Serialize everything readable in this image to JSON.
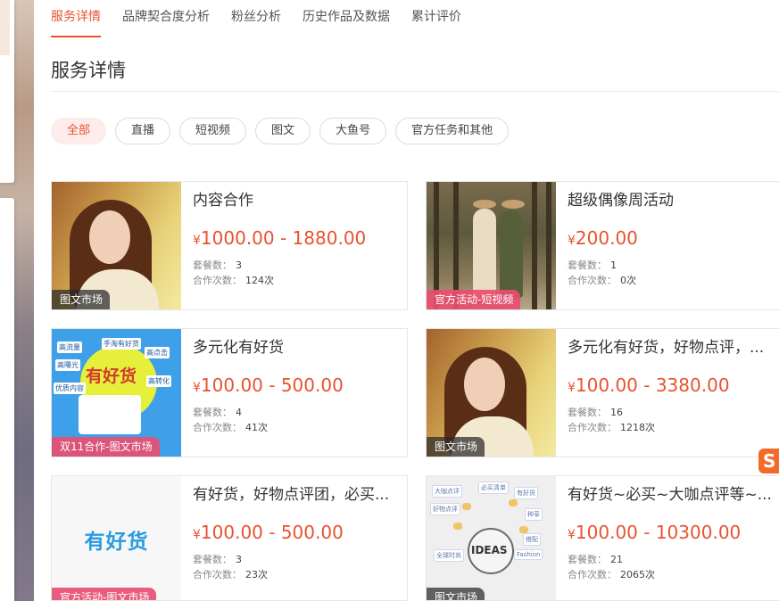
{
  "tabs": [
    {
      "label": "服务详情",
      "active": true
    },
    {
      "label": "品牌契合度分析",
      "active": false
    },
    {
      "label": "粉丝分析",
      "active": false
    },
    {
      "label": "历史作品及数据",
      "active": false
    },
    {
      "label": "累计评价",
      "active": false
    }
  ],
  "section_title": "服务详情",
  "filters": [
    {
      "label": "全部",
      "active": true
    },
    {
      "label": "直播"
    },
    {
      "label": "短视频"
    },
    {
      "label": "图文"
    },
    {
      "label": "大鱼号"
    },
    {
      "label": "官方任务和其他"
    }
  ],
  "labels": {
    "packages": "套餐数：",
    "collabs": "合作次数："
  },
  "currency": "¥",
  "cards": [
    {
      "title": "内容合作",
      "price": "1000.00 - 1880.00",
      "packages": "3",
      "collabs": "124次",
      "tag": "图文市场",
      "tag_style": "dark",
      "image": "portrait-woman"
    },
    {
      "title": "超级偶像周活动",
      "price": "200.00",
      "packages": "1",
      "collabs": "0次",
      "tag": "官方活动-短视频",
      "tag_style": "pink",
      "image": "two-women-forest"
    },
    {
      "title": "多元化有好货",
      "price": "100.00 - 500.00",
      "packages": "4",
      "collabs": "41次",
      "tag": "双11合作-图文市场",
      "tag_style": "pink",
      "image": "youhaohuo-poster"
    },
    {
      "title": "多元化有好货，好物点评，...",
      "price": "100.00 - 3380.00",
      "packages": "16",
      "collabs": "1218次",
      "tag": "图文市场",
      "tag_style": "dark",
      "image": "portrait-woman"
    },
    {
      "title": "有好货，好物点评团，必买...",
      "price": "100.00 - 500.00",
      "packages": "3",
      "collabs": "23次",
      "tag": "官方活动-图文市场",
      "tag_style": "pink",
      "image": "youhaohuo-logo"
    },
    {
      "title": "有好货~必买~大咖点评等~...",
      "price": "100.00 - 10300.00",
      "packages": "21",
      "collabs": "2065次",
      "tag": "图文市场",
      "tag_style": "dark",
      "image": "ideas-bulb"
    }
  ],
  "poster": {
    "big": "有好货",
    "labels": [
      "高流量",
      "手淘有好货",
      "高点击",
      "高曝光",
      "高转化",
      "优质内容"
    ]
  },
  "logo_text": "有好货",
  "ideas": {
    "word": "IDEAS",
    "labels": [
      "大咖点评",
      "必买清单",
      "有好货",
      "好物点评",
      "种草",
      "全球时尚",
      "搭配",
      "Fashion"
    ]
  },
  "corner_logo": "S",
  "colors": {
    "accent": "#e8532f",
    "pink_tag": "#e84e70",
    "chip_active_bg": "#fdecea"
  }
}
